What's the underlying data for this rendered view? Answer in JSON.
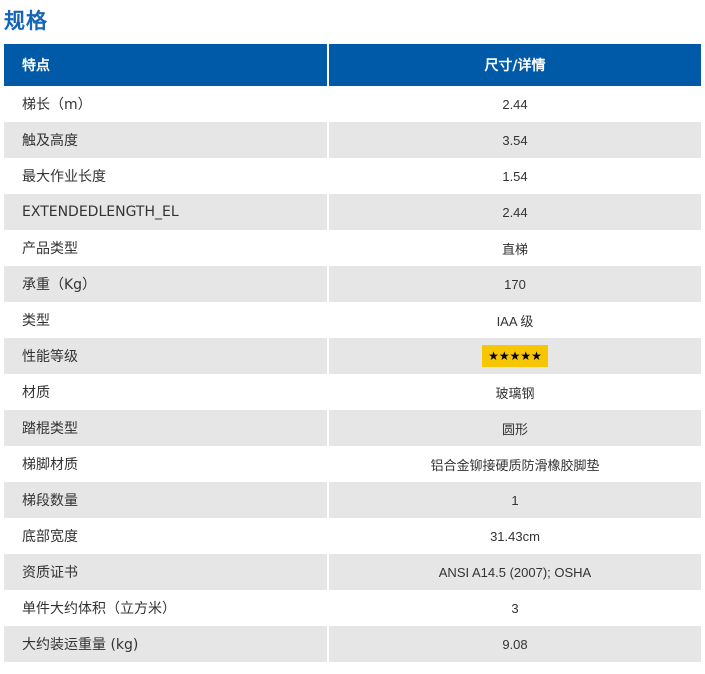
{
  "page": {
    "title": "规格"
  },
  "table": {
    "headers": {
      "feature": "特点",
      "detail": "尺寸/详情"
    },
    "rows": [
      {
        "feature": "梯长（m）",
        "detail": "2.44"
      },
      {
        "feature": "触及高度",
        "detail": "3.54"
      },
      {
        "feature": "最大作业长度",
        "detail": "1.54"
      },
      {
        "feature": "EXTENDEDLENGTH_EL",
        "detail": "2.44"
      },
      {
        "feature": "产品类型",
        "detail": "直梯"
      },
      {
        "feature": "承重（Kg）",
        "detail": "170"
      },
      {
        "feature": "类型",
        "detail": "IAA 级"
      },
      {
        "feature": "性能等级",
        "detail": "★★★★★"
      },
      {
        "feature": "材质",
        "detail": "玻璃钢"
      },
      {
        "feature": "踏棍类型",
        "detail": "圆形"
      },
      {
        "feature": "梯脚材质",
        "detail": "铝合金铆接硬质防滑橡胶脚垫"
      },
      {
        "feature": "梯段数量",
        "detail": "1"
      },
      {
        "feature": "底部宽度",
        "detail": "31.43cm"
      },
      {
        "feature": "资质证书",
        "detail": "ANSI A14.5 (2007); OSHA"
      },
      {
        "feature": "单件大约体积（立方米）",
        "detail": "3"
      },
      {
        "feature": "大约装运重量 (kg)",
        "detail": "9.08"
      }
    ]
  },
  "colors": {
    "title": "#1565b8",
    "header_bg": "#005aa8",
    "row_alt_bg": "#e6e6e6",
    "stars_badge_bg": "#f7c600"
  },
  "rating": {
    "stars": 5,
    "max": 5
  }
}
